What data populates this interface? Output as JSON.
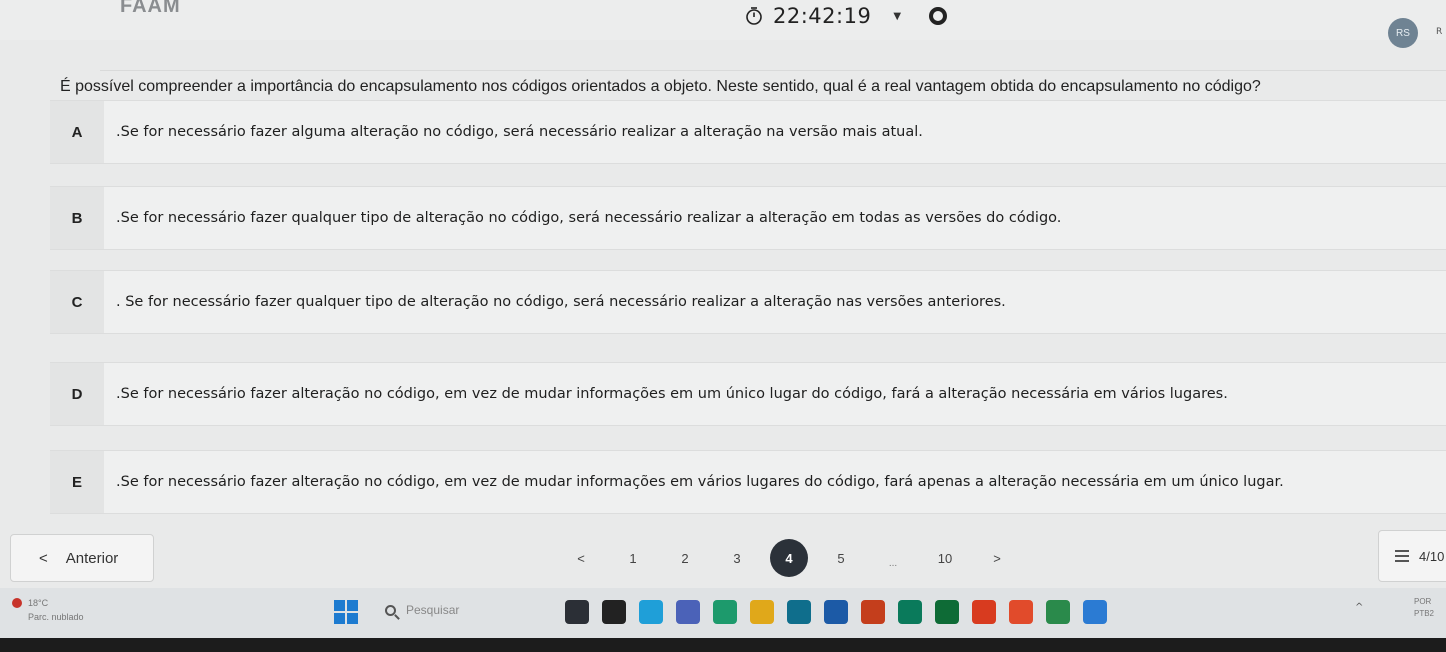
{
  "header": {
    "logo_text": "FAAM",
    "timer": "22:42:19",
    "avatar_initials": "RS",
    "avatar_extra": "R"
  },
  "question": {
    "text": "É possível compreender a importância do encapsulamento nos códigos orientados a objeto. Neste sentido, qual é a real vantagem obtida do encapsulamento no código?"
  },
  "options": [
    {
      "letter": "A",
      "text": ".Se for necessário fazer alguma alteração no código, será necessário realizar a alteração na versão mais atual."
    },
    {
      "letter": "B",
      "text": ".Se for necessário fazer qualquer tipo de alteração no código, será necessário realizar a alteração em todas as versões do código."
    },
    {
      "letter": "C",
      "text": ". Se for necessário fazer qualquer tipo de alteração no código, será necessário realizar a alteração nas versões anteriores."
    },
    {
      "letter": "D",
      "text": ".Se for necessário fazer alteração no código, em vez de mudar informações em um único lugar do código, fará a alteração necessária em vários lugares."
    },
    {
      "letter": "E",
      "text": ".Se for necessário fazer alteração no código, em vez de mudar informações em vários lugares do código, fará apenas a alteração necessária em um único lugar."
    }
  ],
  "nav": {
    "prev_icon": "<",
    "prev_label": "Anterior",
    "pages": [
      "<",
      "1",
      "2",
      "3",
      "4",
      "5",
      "...",
      "10",
      ">"
    ],
    "current_page": "4",
    "progress": "4/10"
  },
  "taskbar": {
    "weather_temp": "18°C",
    "weather_desc": "Parc. nublado",
    "search_placeholder": "Pesquisar",
    "lang_1": "POR",
    "lang_2": "PTB2",
    "tray_chevron": "^",
    "app_colors": [
      "#2b2f36",
      "#222222",
      "#1f9fd8",
      "#4b62b8",
      "#1d9a6c",
      "#e0a81a",
      "#0f6e8c",
      "#1c5aa6",
      "#c43e1c",
      "#0a7a5b",
      "#0e6b36",
      "#d83b1f",
      "#e14b2b",
      "#2a8a4b",
      "#2b7bd3"
    ]
  }
}
